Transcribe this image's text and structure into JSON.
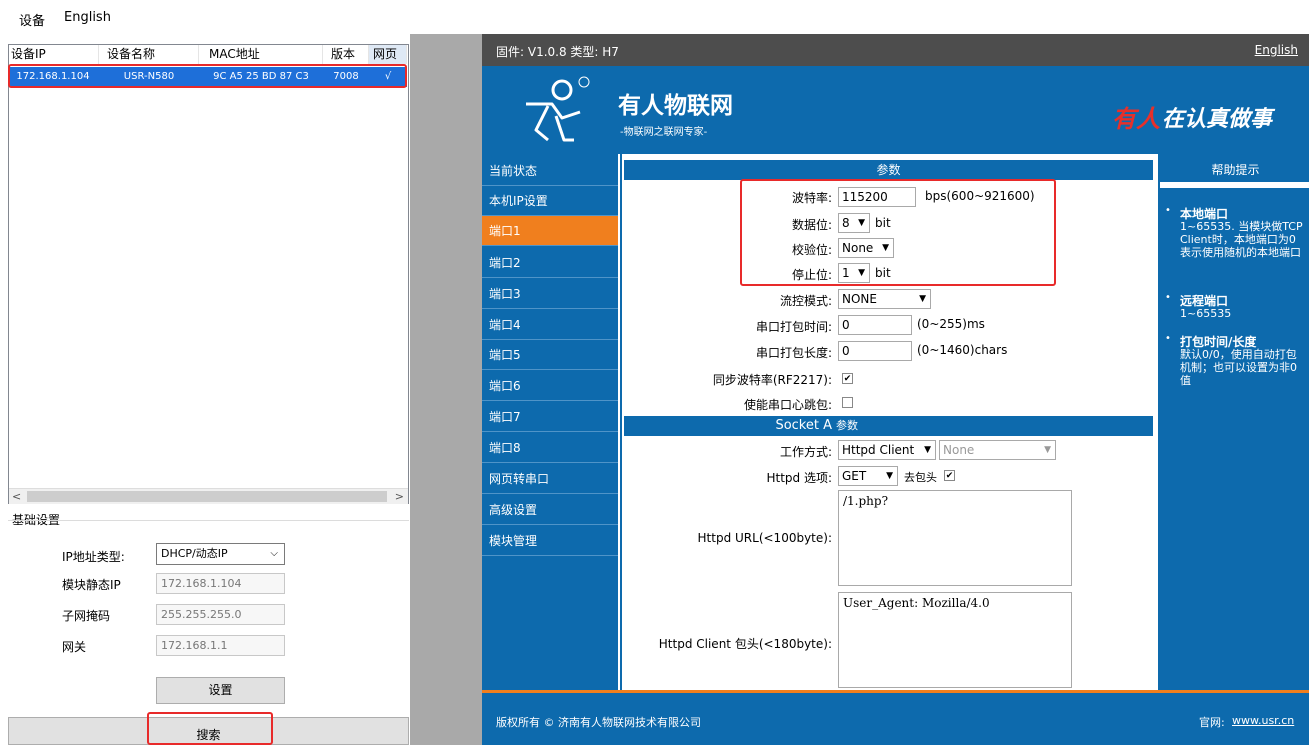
{
  "menubar": {
    "device": "设备",
    "english": "English"
  },
  "device_list": {
    "columns": [
      "设备IP",
      "设备名称",
      "MAC地址",
      "版本",
      "网页"
    ],
    "rows": [
      {
        "ip": "172.168.1.104",
        "name": "USR-N580",
        "mac": "9C A5 25 BD 87 C3",
        "version": "7008",
        "web": "√"
      }
    ]
  },
  "basic_settings": {
    "title": "基础设置",
    "ip_type_label": "IP地址类型:",
    "ip_type_value": "DHCP/动态IP",
    "static_ip_label": "模块静态IP",
    "static_ip_value": "172.168.1.104",
    "mask_label": "子网掩码",
    "mask_value": "255.255.255.0",
    "gateway_label": "网关",
    "gateway_value": "172.168.1.1",
    "set_button": "设置",
    "search_button": "搜索"
  },
  "web": {
    "firmware": "固件: V1.0.8 类型: H7",
    "english_link": "English",
    "brand_name": "有人物联网",
    "brand_sub": "-物联网之联网专家-",
    "slogan_red": "有人",
    "slogan_white": "在认真做事",
    "nav": [
      "当前状态",
      "本机IP设置",
      "端口1",
      "端口2",
      "端口3",
      "端口4",
      "端口5",
      "端口6",
      "端口7",
      "端口8",
      "网页转串口",
      "高级设置",
      "模块管理"
    ],
    "nav_active": "端口1",
    "params_header": "参数",
    "baud_label": "波特率:",
    "baud_value": "115200",
    "baud_hint": "bps(600~921600)",
    "databits_label": "数据位:",
    "databits_value": "8",
    "bit_unit": "bit",
    "parity_label": "校验位:",
    "parity_value": "None",
    "stopbits_label": "停止位:",
    "stopbits_value": "1",
    "flow_label": "流控模式:",
    "flow_value": "NONE",
    "pack_time_label": "串口打包时间:",
    "pack_time_value": "0",
    "pack_time_hint": "(0~255)ms",
    "pack_len_label": "串口打包长度:",
    "pack_len_value": "0",
    "pack_len_hint": "(0~1460)chars",
    "rfc_label": "同步波特率(RF2217):",
    "heartbeat_label": "使能串口心跳包:",
    "socket_label": "Socket A",
    "socket_params": "参数",
    "work_mode_label": "工作方式:",
    "work_mode_value": "Httpd Client",
    "work_mode_second": "None",
    "httpd_option_label": "Httpd 选项:",
    "httpd_option_value": "GET",
    "strip_header_label": "去包头",
    "url_label": "Httpd URL(<100byte):",
    "url_value": "/1.php?",
    "header_label": "Httpd Client 包头(<180byte):",
    "header_value": "User_Agent: Mozilla/4.0",
    "help_header": "帮助提示",
    "help": [
      {
        "title": "本地端口",
        "text": "1~65535. 当模块做TCP Client时，本地端口为0表示使用随机的本地端口"
      },
      {
        "title": "远程端口",
        "text": "1~65535"
      },
      {
        "title": "打包时间/长度",
        "text": "默认0/0，使用自动打包机制；也可以设置为非0值"
      }
    ],
    "copyright": "版权所有 © 济南有人物联网技术有限公司",
    "website_label": "官网:",
    "website": "www.usr.cn"
  },
  "colors": {
    "brand_blue": "#0d6aad",
    "active_orange": "#f07f1e",
    "highlight_red": "#e82a2a",
    "slogan_red": "#e7302a"
  }
}
